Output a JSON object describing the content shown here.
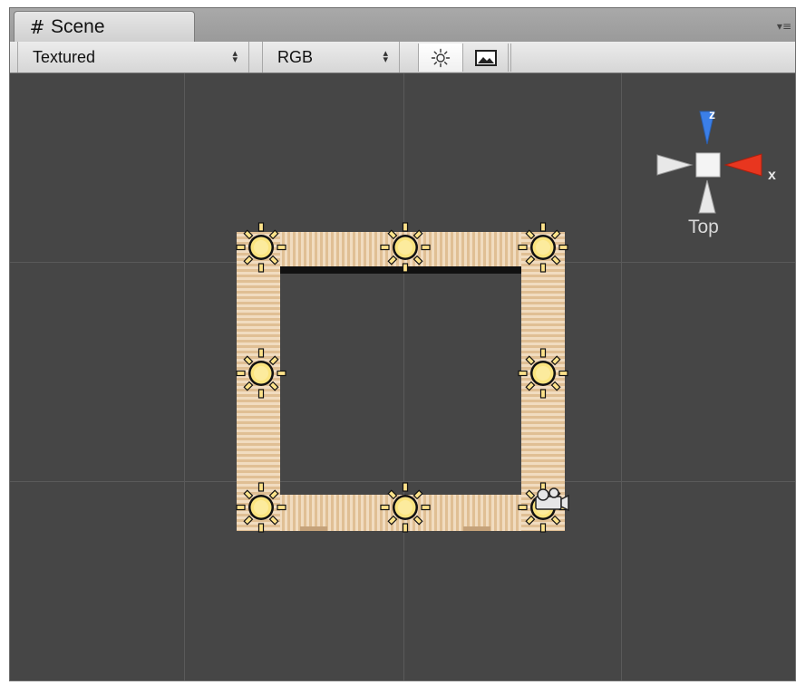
{
  "tab": {
    "title": "Scene",
    "hash_icon": "#",
    "menu_icon": "▾≡"
  },
  "toolbar": {
    "render_mode": "Textured",
    "color_mode": "RGB",
    "scene_lighting_icon": "sun-icon",
    "scene_overlay_icon": "image-icon"
  },
  "gizmo": {
    "view_label": "Top",
    "x_label": "x",
    "z_label": "z",
    "colors": {
      "x_axis": "#e8361f",
      "z_axis": "#3b7fe8",
      "neutral": "#e8e8e8"
    }
  },
  "scene": {
    "object_icons": [
      "light-icon",
      "camera-icon"
    ],
    "light_count": 8,
    "camera_count": 1
  }
}
